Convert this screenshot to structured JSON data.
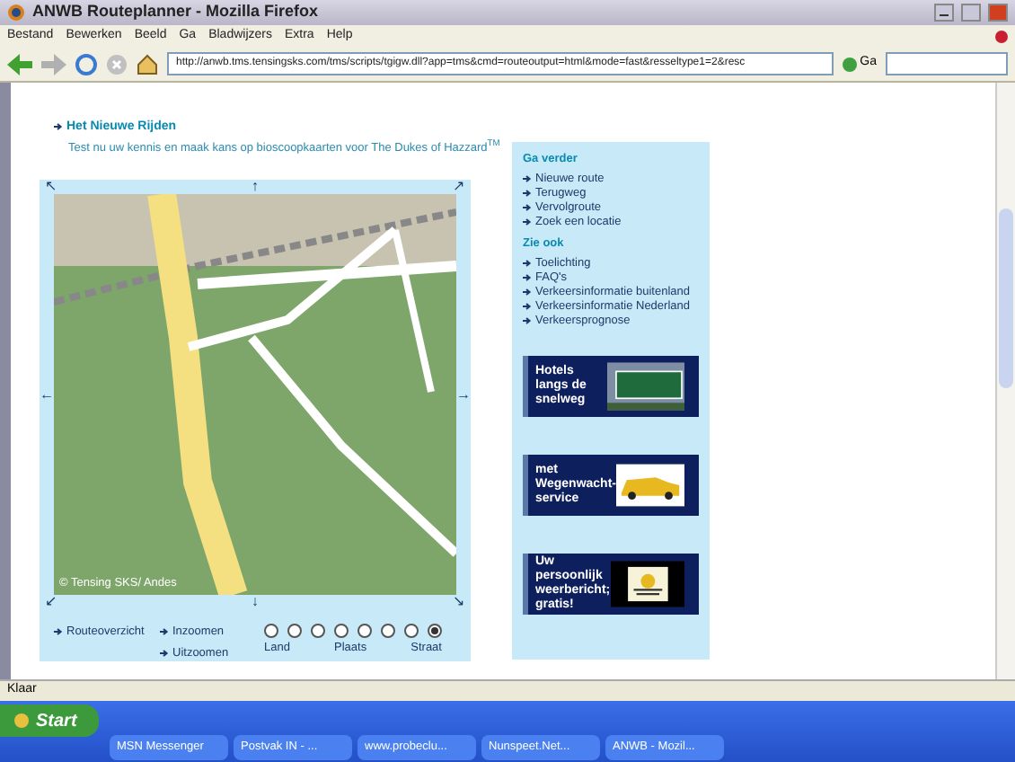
{
  "window": {
    "title": "ANWB Routeplanner - Mozilla Firefox"
  },
  "menu": [
    "Bestand",
    "Bewerken",
    "Beeld",
    "Ga",
    "Bladwijzers",
    "Extra",
    "Help"
  ],
  "address_bar": {
    "value": "http://anwb.tms.tensingsks.com/tms/scripts/tgigw.dll?app=tms&cmd=routeoutput=html&mode=fast&resseltype1=2&resc",
    "go_label": "Ga"
  },
  "promo": {
    "title": "Het Nieuwe Rijden",
    "text": "Test nu uw kennis en maak kans op bioscoopkaarten voor The Dukes of Hazzard$^{TM}$"
  },
  "map": {
    "pan_arrows": [
      "↖",
      "↑",
      "↗",
      "←",
      "→",
      "↙",
      "↓",
      "↘"
    ],
    "copyright": "© Tensing SKS/ Andes",
    "links": [
      {
        "label": "Routeoverzicht"
      },
      {
        "label": "Inzoomen"
      },
      {
        "label": "Uitzoomen"
      }
    ],
    "zoom_levels": [
      {
        "selected": false
      },
      {
        "selected": false
      },
      {
        "selected": false
      },
      {
        "selected": false
      },
      {
        "selected": false
      },
      {
        "selected": false
      },
      {
        "selected": false
      },
      {
        "selected": true
      }
    ],
    "zoom_labels": [
      "Land",
      "Plaats",
      "Straat"
    ]
  },
  "sidebar": {
    "sections": [
      {
        "heading": "Ga verder",
        "links": [
          "Nieuwe route",
          "Terugweg",
          "Vervolgroute",
          "Zoek een locatie"
        ]
      },
      {
        "heading": "Zie ook",
        "links": [
          "Toelichting",
          "FAQ's",
          "Verkeersinformatie buitenland",
          "Verkeersinformatie Nederland",
          "Verkeersprognose"
        ]
      }
    ],
    "banners": [
      {
        "kind": "sign",
        "text": "Hotels langs de snelweg"
      },
      {
        "kind": "car",
        "text": "met Wegenwacht-service"
      },
      {
        "kind": "weather",
        "text": "Uw persoonlijk weerbericht; gratis!"
      }
    ]
  },
  "status_bar": {
    "text": "Klaar"
  },
  "taskbar": {
    "start": "Start",
    "tasks": [
      {
        "label": "MSN Messenger",
        "selected": false
      },
      {
        "label": "Postvak IN - ...",
        "selected": false
      },
      {
        "label": "www.probeclu...",
        "selected": false
      },
      {
        "label": "Nunspeet.Net...",
        "selected": false
      },
      {
        "label": "ANWB - Mozil...",
        "selected": false
      }
    ]
  }
}
